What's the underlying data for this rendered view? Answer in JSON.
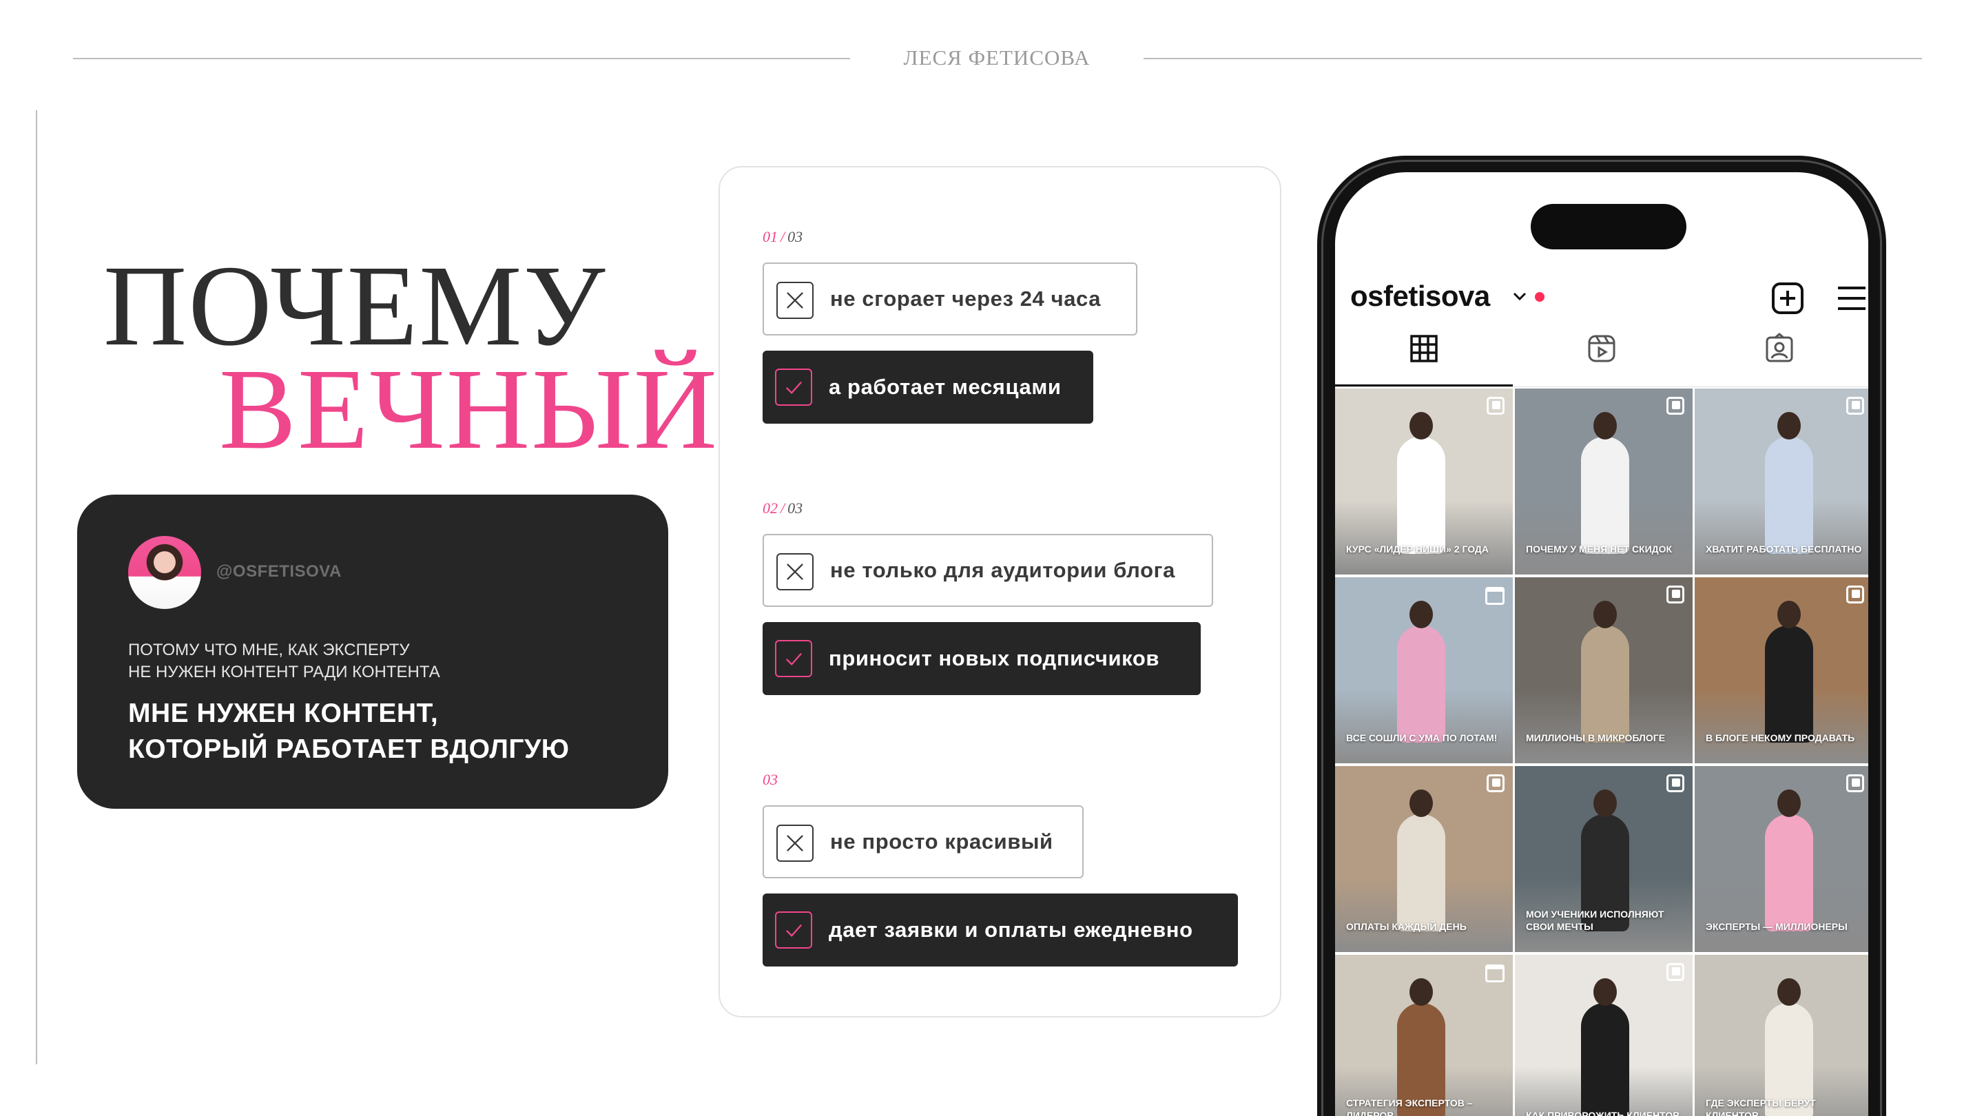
{
  "header": {
    "brand": "ЛЕСЯ ФЕТИСОВА"
  },
  "title": {
    "line1": "ПОЧЕМУ",
    "line2": "ВЕЧНЫЙ?"
  },
  "profile_card": {
    "handle": "@OSFETISOVA",
    "sub_line1": "ПОТОМУ ЧТО МНЕ, КАК ЭКСПЕРТУ",
    "sub_line2": "НЕ НУЖЕН КОНТЕНТ РАДИ КОНТЕНТА",
    "main_line1": "МНЕ НУЖЕН КОНТЕНТ,",
    "main_line2": "КОТОРЫЙ РАБОТАЕТ ВДОЛГУЮ"
  },
  "comparisons": [
    {
      "num_current": "01",
      "num_total": "03",
      "negative": "не сгорает через 24 часа",
      "positive": "а работает месяцами"
    },
    {
      "num_current": "02",
      "num_total": "03",
      "negative": "не только для аудитории блога",
      "positive": "приносит новых подписчиков"
    },
    {
      "num_current": "03",
      "num_total": "",
      "negative": "не просто красивый",
      "positive": "дает заявки и оплаты ежедневно"
    }
  ],
  "phone": {
    "username": "osfetisova",
    "tabs": [
      "grid-icon",
      "reels-icon",
      "tagged-icon"
    ],
    "posts": [
      {
        "caption": "КУРС «ЛИДЕР НИШИ» 2 ГОДА",
        "badge": "multi",
        "bg": "#d9d4cc",
        "accent": "#ffffff"
      },
      {
        "caption": "ПОЧЕМУ У МЕНЯ НЕТ СКИДОК",
        "badge": "multi",
        "bg": "#8a9299",
        "accent": "#f2f2f2"
      },
      {
        "caption": "ХВАТИТ РАБОТАТЬ БЕСПЛАТНО",
        "badge": "multi",
        "bg": "#b9c2c8",
        "accent": "#c9d6ea"
      },
      {
        "caption": "ВСЕ СОШЛИ С УМА ПО ЛОТАМ!",
        "badge": "calendar",
        "bg": "#aab8c4",
        "accent": "#e8a6c4"
      },
      {
        "caption": "МИЛЛИОНЫ В МИКРОБЛОГЕ",
        "badge": "multi",
        "bg": "#6f6a64",
        "accent": "#b7a48a"
      },
      {
        "caption": "В БЛОГЕ НЕКОМУ ПРОДАВАТЬ",
        "badge": "multi",
        "bg": "#a07a58",
        "accent": "#1e1e1e"
      },
      {
        "caption": "ОПЛАТЫ КАЖДЫЙ ДЕНЬ",
        "badge": "multi",
        "bg": "#b49c84",
        "accent": "#e4ddd2"
      },
      {
        "caption": "МОИ УЧЕНИКИ ИСПОЛНЯЮТ СВОИ МЕЧТЫ",
        "badge": "multi",
        "bg": "#5e6a70",
        "accent": "#2a2a2a"
      },
      {
        "caption": "ЭКСПЕРТЫ — МИЛЛИОНЕРЫ",
        "badge": "multi",
        "bg": "#8a8f93",
        "accent": "#f2a6c2"
      },
      {
        "caption": "СТРАТЕГИЯ ЭКСПЕРТОВ – ЛИДЕРОВ",
        "badge": "calendar",
        "bg": "#cfc8bd",
        "accent": "#8b5a3a"
      },
      {
        "caption": "КАК ПРИВОРОЖИТЬ КЛИЕНТОВ",
        "badge": "multi",
        "bg": "#e9e6e1",
        "accent": "#1e1e1e"
      },
      {
        "caption": "ГДЕ ЭКСПЕРТЫ БЕРУТ КЛИЕНТОВ",
        "badge": "",
        "bg": "#c8c4bc",
        "accent": "#eeeae2"
      }
    ]
  },
  "colors": {
    "pink": "#f0468c",
    "dark": "#262626"
  }
}
